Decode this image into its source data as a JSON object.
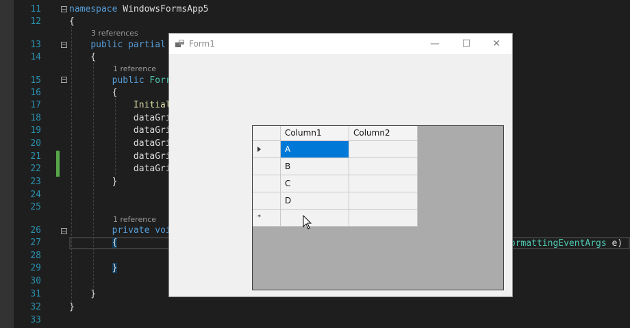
{
  "editor": {
    "lines": [
      {
        "num": "11",
        "parts": [
          {
            "t": "namespace",
            "c": "kw"
          },
          {
            "t": " WindowsFormsApp5",
            "c": ""
          }
        ]
      },
      {
        "num": "12",
        "parts": [
          {
            "t": "{",
            "c": ""
          }
        ]
      },
      {
        "num": "13",
        "parts": [
          {
            "t": "    ",
            "c": ""
          },
          {
            "t": "public",
            "c": "kw"
          },
          {
            "t": " ",
            "c": ""
          },
          {
            "t": "partial",
            "c": "kw"
          }
        ]
      },
      {
        "num": "14",
        "parts": [
          {
            "t": "    {",
            "c": ""
          }
        ]
      },
      {
        "num": "15",
        "parts": [
          {
            "t": "        ",
            "c": ""
          },
          {
            "t": "public",
            "c": "kw"
          },
          {
            "t": " ",
            "c": ""
          },
          {
            "t": "Forr",
            "c": "ty"
          }
        ]
      },
      {
        "num": "16",
        "parts": [
          {
            "t": "        {",
            "c": ""
          }
        ]
      },
      {
        "num": "17",
        "parts": [
          {
            "t": "            ",
            "c": ""
          },
          {
            "t": "Initial",
            "c": "fn"
          }
        ]
      },
      {
        "num": "18",
        "parts": [
          {
            "t": "            dataGri",
            "c": ""
          }
        ]
      },
      {
        "num": "19",
        "parts": [
          {
            "t": "            dataGri",
            "c": ""
          }
        ]
      },
      {
        "num": "20",
        "parts": [
          {
            "t": "            dataGri",
            "c": ""
          }
        ]
      },
      {
        "num": "21",
        "parts": [
          {
            "t": "            dataGri",
            "c": ""
          }
        ]
      },
      {
        "num": "22",
        "parts": [
          {
            "t": "            dataGri",
            "c": ""
          }
        ]
      },
      {
        "num": "23",
        "parts": [
          {
            "t": "        }",
            "c": ""
          }
        ]
      },
      {
        "num": "24",
        "parts": []
      },
      {
        "num": "25",
        "parts": []
      },
      {
        "num": "26",
        "parts": [
          {
            "t": "        ",
            "c": ""
          },
          {
            "t": "private",
            "c": "kw"
          },
          {
            "t": " ",
            "c": ""
          },
          {
            "t": "voi",
            "c": "kw"
          }
        ]
      },
      {
        "num": "27",
        "parts": [
          {
            "t": "        ",
            "c": ""
          },
          {
            "t": "{",
            "c": "brace-hl"
          }
        ]
      },
      {
        "num": "28",
        "parts": []
      },
      {
        "num": "29",
        "parts": [
          {
            "t": "        ",
            "c": ""
          },
          {
            "t": "}",
            "c": "brace-hl"
          }
        ]
      },
      {
        "num": "30",
        "parts": []
      },
      {
        "num": "31",
        "parts": [
          {
            "t": "    }",
            "c": ""
          }
        ]
      },
      {
        "num": "32",
        "parts": [
          {
            "t": "}",
            "c": ""
          }
        ]
      },
      {
        "num": "33",
        "parts": []
      }
    ],
    "code_tail_26": [
      {
        "t": "FormattingEventArgs",
        "c": "ty"
      },
      {
        "t": " e)",
        "c": ""
      }
    ],
    "ref_class": "3 references",
    "ref_ctor": "1 reference",
    "ref_method": "1 reference"
  },
  "form": {
    "title": "Form1",
    "minimize": "—",
    "maximize": "☐",
    "close": "✕"
  },
  "grid": {
    "columns": [
      "Column1",
      "Column2"
    ],
    "rows": [
      {
        "col1": "A",
        "col2": "",
        "selected": true,
        "current": true
      },
      {
        "col1": "B",
        "col2": ""
      },
      {
        "col1": "C",
        "col2": ""
      },
      {
        "col1": "D",
        "col2": ""
      }
    ],
    "new_row_marker": "*"
  },
  "colors": {
    "editor_bg": "#1e1e1e",
    "keyword": "#569cd6",
    "type": "#4ec9b0",
    "method": "#dcdcaa",
    "line_number": "#2b91af",
    "selection": "#0078d7",
    "grid_background": "#ababab"
  }
}
